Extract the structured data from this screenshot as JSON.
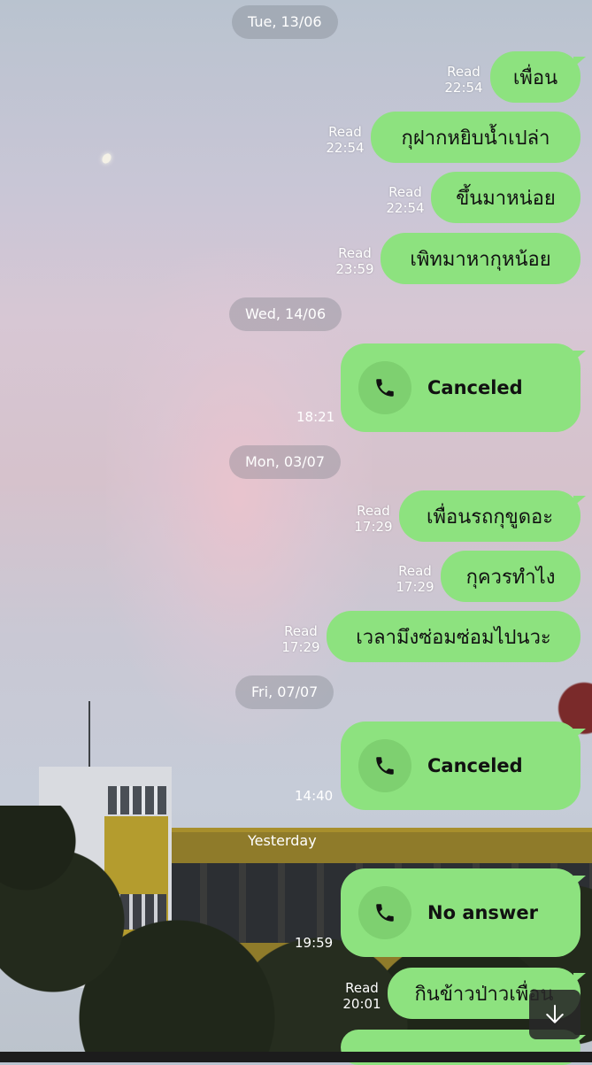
{
  "chat": {
    "messages": [
      {
        "date": "Tue, 13/06"
      },
      {
        "read": "Read",
        "time": "22:54",
        "text": "เพื่อน"
      },
      {
        "read": "Read",
        "time": "22:54",
        "text": "กุฝากหยิบน้ำเปล่า"
      },
      {
        "read": "Read",
        "time": "22:54",
        "text": "ขึ้นมาหน่อย"
      },
      {
        "read": "Read",
        "time": "23:59",
        "text": "เพิทมาหากุหน้อย"
      },
      {
        "date": "Wed, 14/06"
      },
      {
        "call": "Canceled",
        "time": "18:21"
      },
      {
        "date": "Mon, 03/07"
      },
      {
        "read": "Read",
        "time": "17:29",
        "text": "เพื่อนรถกุขูดอะ"
      },
      {
        "read": "Read",
        "time": "17:29",
        "text": "กุควรทำไง"
      },
      {
        "read": "Read",
        "time": "17:29",
        "text": "เวลามึงซ่อมซ่อมไปนวะ"
      },
      {
        "date": "Fri, 07/07"
      },
      {
        "call": "Canceled",
        "time": "14:40"
      },
      {
        "date": "Yesterday"
      },
      {
        "call": "No answer",
        "time": "19:59"
      },
      {
        "read": "Read",
        "time": "20:01",
        "text": "กินข้าวป่าวเพื่อน"
      }
    ]
  },
  "icons": {
    "phone": "phone-icon",
    "scroll": "arrow-down-icon"
  },
  "colors": {
    "bubble": "#8de27f",
    "call_icon_bg": "#7ed070"
  }
}
